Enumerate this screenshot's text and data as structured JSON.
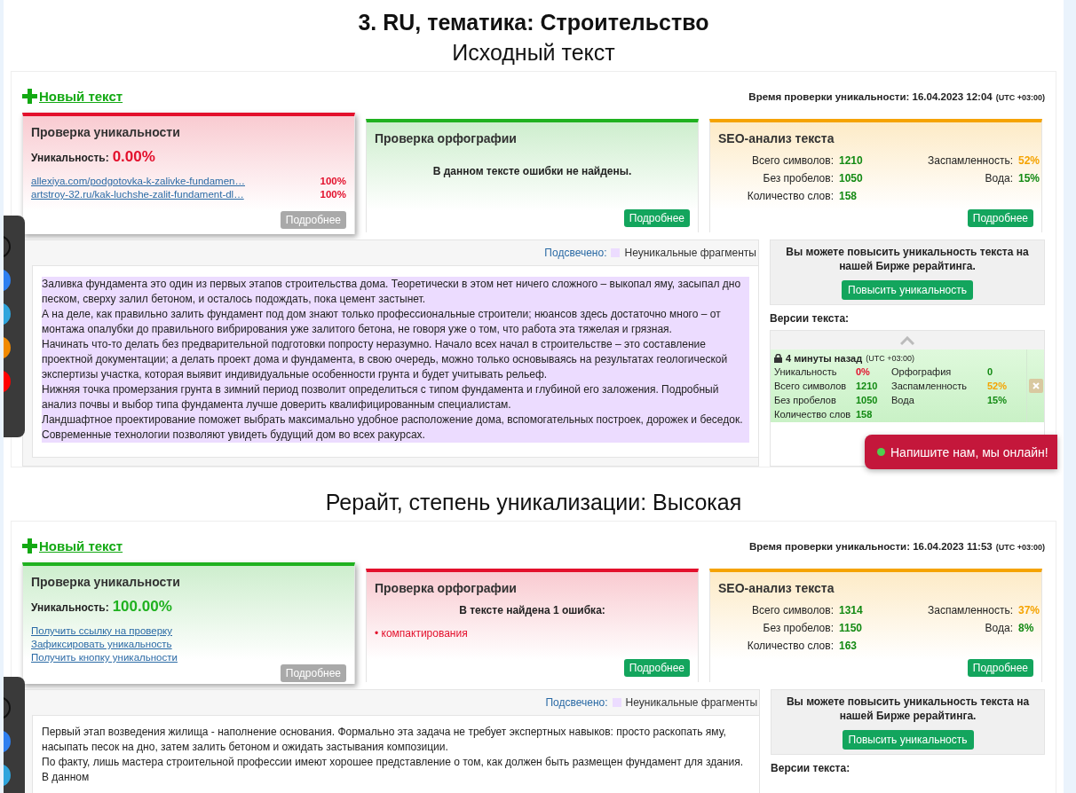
{
  "sections": [
    {
      "heading": "3. RU, тематика: Строительство",
      "title": "Исходный текст",
      "new_text": "Новый текст",
      "check_time": "Время проверки уникальности: 16.04.2023 12:04",
      "timezone": "(UTC +03:00)",
      "uniqueness": {
        "title": "Проверка уникальности",
        "color": "#e3102c",
        "label": "Уникальность:",
        "value": "0.00%",
        "matches": [
          {
            "url": "allexiya.com/podgotovka-k-zalivke-fundamen…",
            "percent": "100%"
          },
          {
            "url": "artstroy-32.ru/kak-luchshe-zalit-fundament-dl…",
            "percent": "100%"
          }
        ],
        "button": "Подробнее",
        "disabled": true
      },
      "spelling": {
        "title": "Проверка орфографии",
        "color": "#1fb11f",
        "message": "В данном тексте ошибки не найдены.",
        "button": "Подробнее"
      },
      "seo": {
        "title": "SEO-анализ текста",
        "color": "#f5a300",
        "stats": [
          {
            "label": "Всего символов:",
            "value": "1210",
            "color": "#138a13"
          },
          {
            "label": "Заспамленность:",
            "value": "52%",
            "color": "#f5a300"
          },
          {
            "label": "Без пробелов:",
            "value": "1050",
            "color": "#138a13"
          },
          {
            "label": "Вода:",
            "value": "15%",
            "color": "#138a13"
          },
          {
            "label": "Количество слов:",
            "value": "158",
            "color": "#138a13"
          }
        ],
        "button": "Подробнее"
      },
      "legend": {
        "label": "Подсвечено:",
        "text": "Неуникальные фрагменты"
      },
      "text": {
        "highlighted": true,
        "paragraphs": [
          "Заливка фундамента это один из первых этапов строительства дома. Теоретически в этом нет ничего сложного – выкопал яму, засыпал дно песком, сверху залил бетоном, и осталось подождать, пока цемент застынет.",
          "А на деле, как правильно залить фундамент под дом знают только профессиональные строители; нюансов здесь достаточно много – от монтажа опалубки до правильного вибрирования уже залитого бетона, не говоря уже о том, что работа эта тяжелая и грязная.",
          "Начинать что-то делать без предварительной подготовки попросту неразумно. Начало всех начал в строительстве – это составление проектной документации; а делать проект дома и фундамента, в свою очередь, можно только основываясь на результатах геологической экспертизы участка, которая выявит индивидуальные особенности грунта и будет учитывать рельеф.",
          "Нижняя точка промерзания грунта в зимний период позволит определиться с типом фундамента и глубиной его заложения. Подробный анализ почвы и выбор типа фундамента лучше доверить квалифицированным специалистам.",
          "Ландшафтное проектирование поможет выбрать максимально удобное расположение дома, вспомогательных построек, дорожек и беседок. Современные технологии позволяют увидеть будущий дом во всех ракурсах."
        ]
      },
      "promo": {
        "text": "Вы можете повысить уникальность текста на нашей Бирже рерайтинга.",
        "button": "Повысить уникальность"
      },
      "versions": {
        "title": "Версии текста:",
        "items": [
          {
            "time": "4 минуты назад",
            "timezone": "(UTC +03:00)",
            "locked": true,
            "stats": [
              {
                "label": "Уникальность",
                "value": "0%",
                "color": "#e3102c"
              },
              {
                "label": "Орфография",
                "value": "0",
                "color": "#138a13"
              },
              {
                "label": "Всего символов",
                "value": "1210",
                "color": "#138a13"
              },
              {
                "label": "Заспамленность",
                "value": "52%",
                "color": "#f5a300"
              },
              {
                "label": "Без пробелов",
                "value": "1050",
                "color": "#138a13"
              },
              {
                "label": "Вода",
                "value": "15%",
                "color": "#138a13"
              },
              {
                "label": "Количество слов",
                "value": "158",
                "color": "#138a13"
              }
            ]
          }
        ]
      }
    },
    {
      "title": "Рерайт, степень уникализации: Высокая",
      "new_text": "Новый текст",
      "check_time": "Время проверки уникальности: 16.04.2023 11:53",
      "timezone": "(UTC +03:00)",
      "uniqueness": {
        "title": "Проверка уникальности",
        "color": "#1fb11f",
        "label": "Уникальность:",
        "value": "100.00%",
        "links": [
          "Получить ссылку на проверку",
          "Зафиксировать уникальность",
          "Получить кнопку уникальности"
        ],
        "button": "Подробнее",
        "disabled": true
      },
      "spelling": {
        "title": "Проверка орфографии",
        "color": "#e3102c",
        "message": "В тексте найдена 1 ошибка:",
        "errors": [
          "• компактирования"
        ],
        "button": "Подробнее"
      },
      "seo": {
        "title": "SEO-анализ текста",
        "color": "#f5a300",
        "stats": [
          {
            "label": "Всего символов:",
            "value": "1314",
            "color": "#138a13"
          },
          {
            "label": "Заспамленность:",
            "value": "37%",
            "color": "#f5a300"
          },
          {
            "label": "Без пробелов:",
            "value": "1150",
            "color": "#138a13"
          },
          {
            "label": "Вода:",
            "value": "8%",
            "color": "#138a13"
          },
          {
            "label": "Количество слов:",
            "value": "163",
            "color": "#138a13"
          }
        ],
        "button": "Подробнее"
      },
      "legend": {
        "label": "Подсвечено:",
        "text": "Неуникальные фрагменты"
      },
      "text": {
        "highlighted": false,
        "paragraphs": [
          "Первый этап возведения жилища - наполнение основания. Формально эта задача не требует экспертных навыков: просто раскопать яму, насыпать песок на дно, затем залить бетоном и ожидать застывания композиции.",
          "По факту, лишь мастера строительной профессии имеют хорошее представление о том, как должен быть размещен фундамент для здания. В данном"
        ]
      },
      "promo": {
        "text": "Вы можете повысить уникальность текста на нашей Бирже рерайтинга.",
        "button": "Повысить уникальность"
      },
      "versions": {
        "title": "Версии текста:"
      }
    }
  ],
  "chat": {
    "text": "Напишите нам, мы онлайн!"
  }
}
